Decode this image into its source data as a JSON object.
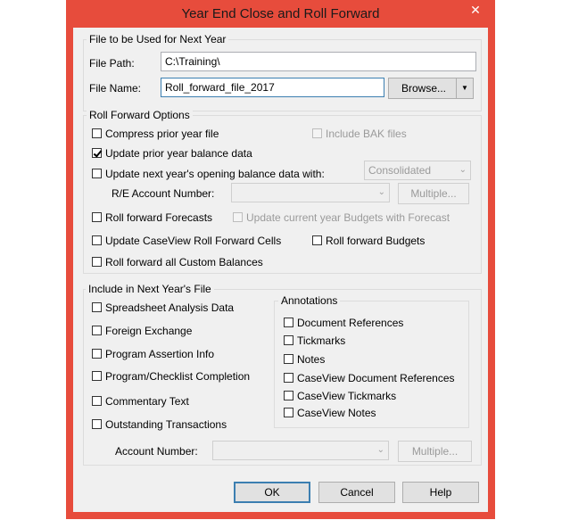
{
  "window": {
    "title": "Year End Close and Roll Forward",
    "close_glyph": "✕"
  },
  "file_group": {
    "label": "File to be Used for Next Year",
    "file_path_label": "File Path:",
    "file_path_value": "C:\\Training\\",
    "file_name_label": "File Name:",
    "file_name_value": "Roll_forward_file_2017",
    "browse_label": "Browse...",
    "dropdown_glyph": "▼"
  },
  "roll_forward_options": {
    "label": "Roll Forward Options",
    "compress_prior_year": {
      "label": "Compress prior year file",
      "checked": false
    },
    "include_bak": {
      "label": "Include BAK files",
      "checked": false,
      "enabled": false
    },
    "update_prior_year_balance": {
      "label": "Update prior year balance data",
      "checked": true
    },
    "update_next_year_opening": {
      "label": "Update next year's opening balance data with:",
      "checked": false
    },
    "opening_source_value": "Consolidated",
    "re_account_label": "R/E Account Number:",
    "re_multiple_label": "Multiple...",
    "roll_forecasts": {
      "label": "Roll forward Forecasts",
      "checked": false
    },
    "update_budgets_with_forecast": {
      "label": "Update current year Budgets with Forecast",
      "checked": false,
      "enabled": false
    },
    "update_caseview_cells": {
      "label": "Update CaseView Roll Forward Cells",
      "checked": false
    },
    "roll_budgets": {
      "label": "Roll forward Budgets",
      "checked": false
    },
    "roll_custom_balances": {
      "label": "Roll forward all Custom Balances",
      "checked": false
    }
  },
  "include_group": {
    "label": "Include in Next Year's File",
    "items": [
      {
        "label": "Spreadsheet Analysis Data",
        "checked": false
      },
      {
        "label": "Foreign Exchange",
        "checked": false
      },
      {
        "label": "Program Assertion Info",
        "checked": false
      },
      {
        "label": "Program/Checklist Completion",
        "checked": false
      },
      {
        "label": "Commentary Text",
        "checked": false
      },
      {
        "label": "Outstanding Transactions",
        "checked": false
      }
    ],
    "annotations_label": "Annotations",
    "annotations": [
      {
        "label": "Document References",
        "checked": false
      },
      {
        "label": "Tickmarks",
        "checked": false
      },
      {
        "label": "Notes",
        "checked": false
      },
      {
        "label": "CaseView Document References",
        "checked": false
      },
      {
        "label": "CaseView Tickmarks",
        "checked": false
      },
      {
        "label": "CaseView Notes",
        "checked": false
      }
    ],
    "account_number_label": "Account Number:",
    "account_multiple_label": "Multiple..."
  },
  "footer": {
    "ok_label": "OK",
    "cancel_label": "Cancel",
    "help_label": "Help"
  }
}
